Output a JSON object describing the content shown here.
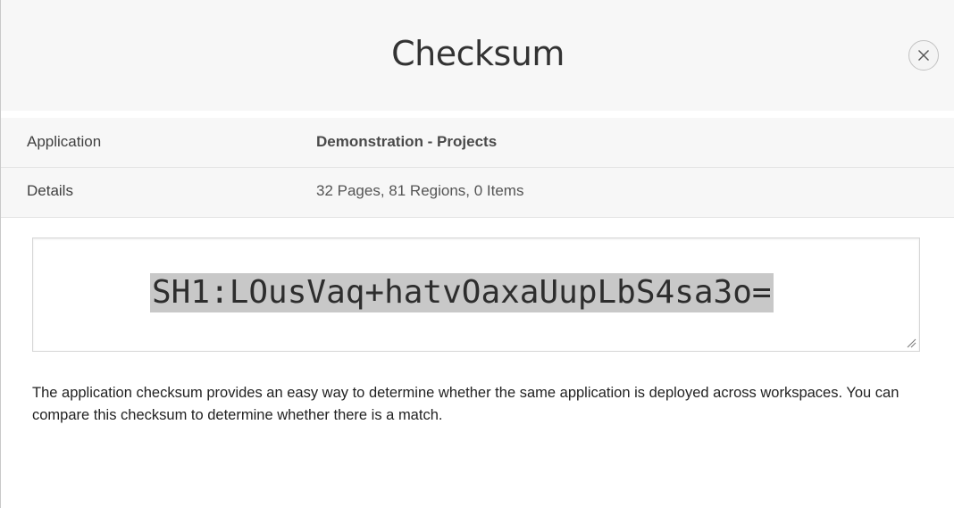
{
  "dialog": {
    "title": "Checksum",
    "close_icon": "close-icon"
  },
  "info": {
    "application_label": "Application",
    "application_value": "Demonstration - Projects",
    "details_label": "Details",
    "details_value": "32 Pages, 81 Regions, 0 Items"
  },
  "checksum": {
    "value": "SH1:LOusVaq+hatvOaxaUupLbS4sa3o="
  },
  "description": "The application checksum provides an easy way to determine whether the same application is deployed across workspaces. You can compare this checksum to determine whether there is a match."
}
